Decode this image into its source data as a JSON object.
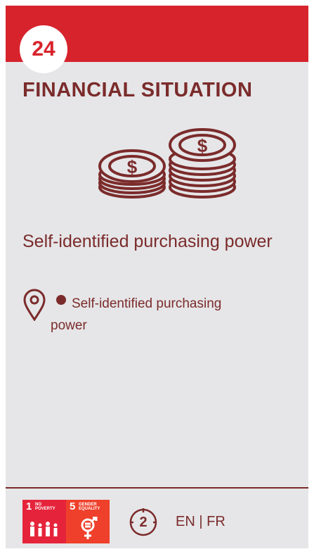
{
  "card": {
    "number": "24",
    "title": "FINANCIAL SITUATION",
    "icon": "coins-stack-icon",
    "subtitle": "Self-identified purchasing power",
    "location": {
      "icon": "location-pin-icon",
      "text_line1": "Self-identified purchasing",
      "text_line2": "power"
    }
  },
  "footer": {
    "sdgs": [
      {
        "number": "1",
        "label_line1": "NO",
        "label_line2": "POVERTY",
        "color": "#e5243b"
      },
      {
        "number": "5",
        "label_line1": "GENDER",
        "label_line2": "EQUALITY",
        "color": "#ef402b"
      }
    ],
    "count": "2",
    "lang_en": "EN",
    "lang_sep": "|",
    "lang_fr": "FR"
  },
  "colors": {
    "band": "#d7232c",
    "text": "#7b2b2b",
    "background": "#e6e6e8"
  }
}
